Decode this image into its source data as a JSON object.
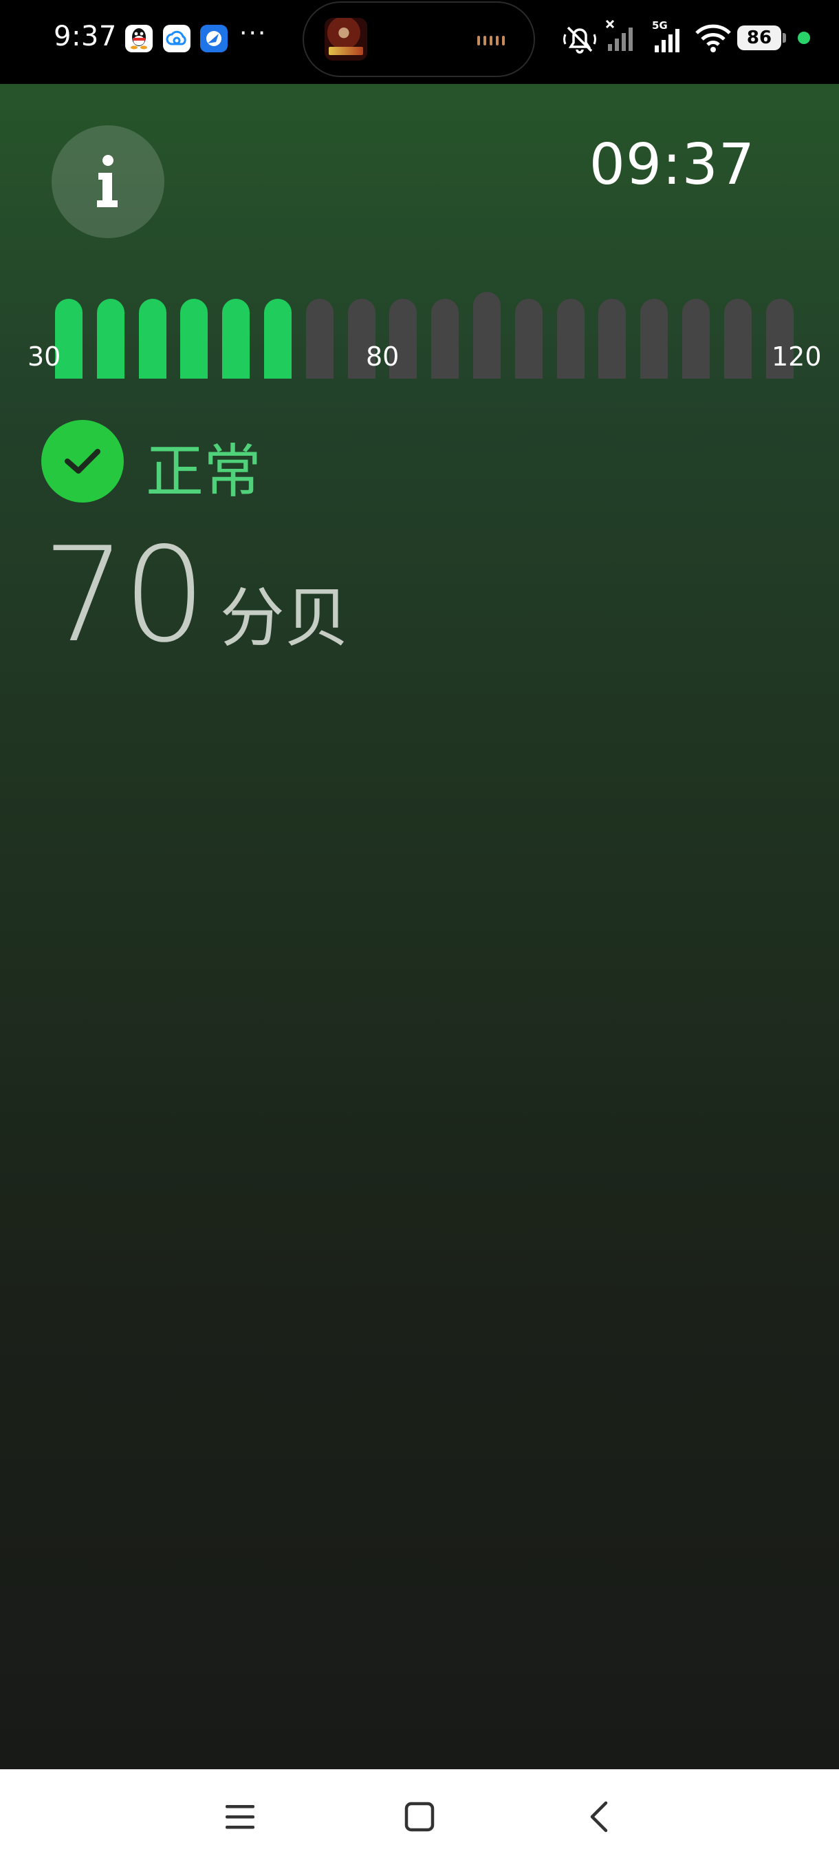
{
  "status_bar": {
    "time": "9:37",
    "battery": "86",
    "notification_icons": [
      "qq-icon",
      "cloud-drive-icon",
      "browser-icon"
    ],
    "more_indicator": "···",
    "network": "5G",
    "accent_dot_color": "#2ad36a"
  },
  "app": {
    "clock": "09:37",
    "meter": {
      "min_label": "30",
      "mid_label": "80",
      "max_label": "120",
      "total_bars": 18,
      "active_bars": 6,
      "active_color": "#1fcc5c",
      "inactive_color": "#454545"
    },
    "status": {
      "label": "正常",
      "color": "#4fd27a"
    },
    "reading": {
      "value": "70",
      "unit": "分贝"
    }
  },
  "nav_bar": {
    "buttons": [
      "menu-icon",
      "home-icon",
      "back-icon"
    ]
  }
}
